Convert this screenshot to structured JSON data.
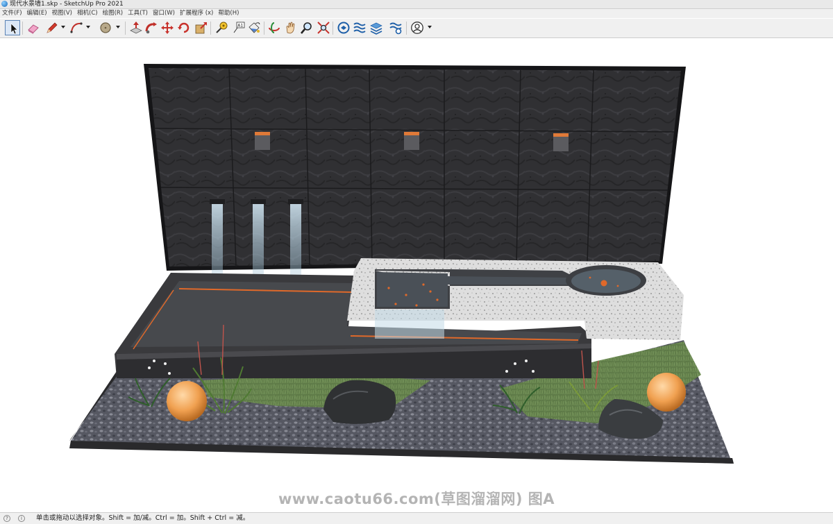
{
  "window": {
    "title": "现代水景墙1.skp - SketchUp Pro 2021"
  },
  "menu": {
    "items": [
      {
        "label": "文件(F)"
      },
      {
        "label": "编辑(E)"
      },
      {
        "label": "视图(V)"
      },
      {
        "label": "相机(C)"
      },
      {
        "label": "绘图(R)"
      },
      {
        "label": "工具(T)"
      },
      {
        "label": "窗口(W)"
      },
      {
        "label": "扩展程序 (x)"
      },
      {
        "label": "帮助(H)"
      }
    ]
  },
  "toolbar": {
    "tools": [
      {
        "name": "select-tool-button",
        "icon": "select-arrow-icon",
        "active": true
      },
      {
        "name": "eraser-tool-button",
        "icon": "eraser-icon"
      },
      {
        "name": "line-tool-button",
        "icon": "pencil-icon"
      },
      {
        "name": "arc-tool-button",
        "icon": "arc-icon"
      },
      {
        "name": "shape-tool-button",
        "icon": "circle-shape-icon"
      },
      {
        "name": "push-pull-tool-button",
        "icon": "push-pull-icon"
      },
      {
        "name": "follow-me-tool-button",
        "icon": "follow-me-icon"
      },
      {
        "name": "move-tool-button",
        "icon": "move-icon"
      },
      {
        "name": "rotate-tool-button",
        "icon": "rotate-icon"
      },
      {
        "name": "scale-tool-button",
        "icon": "scale-icon"
      },
      {
        "name": "tape-measure-tool-button",
        "icon": "tape-measure-icon"
      },
      {
        "name": "text-tool-button",
        "icon": "text-label-icon"
      },
      {
        "name": "paint-bucket-tool-button",
        "icon": "paint-bucket-icon"
      },
      {
        "name": "orbit-tool-button",
        "icon": "orbit-icon"
      },
      {
        "name": "pan-tool-button",
        "icon": "pan-hand-icon"
      },
      {
        "name": "zoom-tool-button",
        "icon": "zoom-magnifier-icon"
      },
      {
        "name": "zoom-extents-button",
        "icon": "zoom-extents-icon"
      },
      {
        "name": "3d-warehouse-button",
        "icon": "warehouse-icon"
      },
      {
        "name": "extension-warehouse-button",
        "icon": "extension-warehouse-icon"
      },
      {
        "name": "layout-button",
        "icon": "layers-stack-icon"
      },
      {
        "name": "extension-manager-button",
        "icon": "extension-manager-icon"
      },
      {
        "name": "account-button",
        "icon": "user-account-icon"
      }
    ]
  },
  "watermark": {
    "text": "www.caotu66.com(草图溜溜网) 图A"
  },
  "status": {
    "text": "单击或拖动以选择对象。Shift = 加/减。Ctrl = 加。Shift + Ctrl = 减。"
  },
  "colors": {
    "wall_stone": "#2f2f31",
    "pool_water": "#46484c",
    "planter_edge": "#3a3a3c",
    "terrazzo": "#dcdcdc",
    "gravel": "#5d5f69",
    "grass": "#5d7a45",
    "accent_orange": "#e0692a"
  }
}
